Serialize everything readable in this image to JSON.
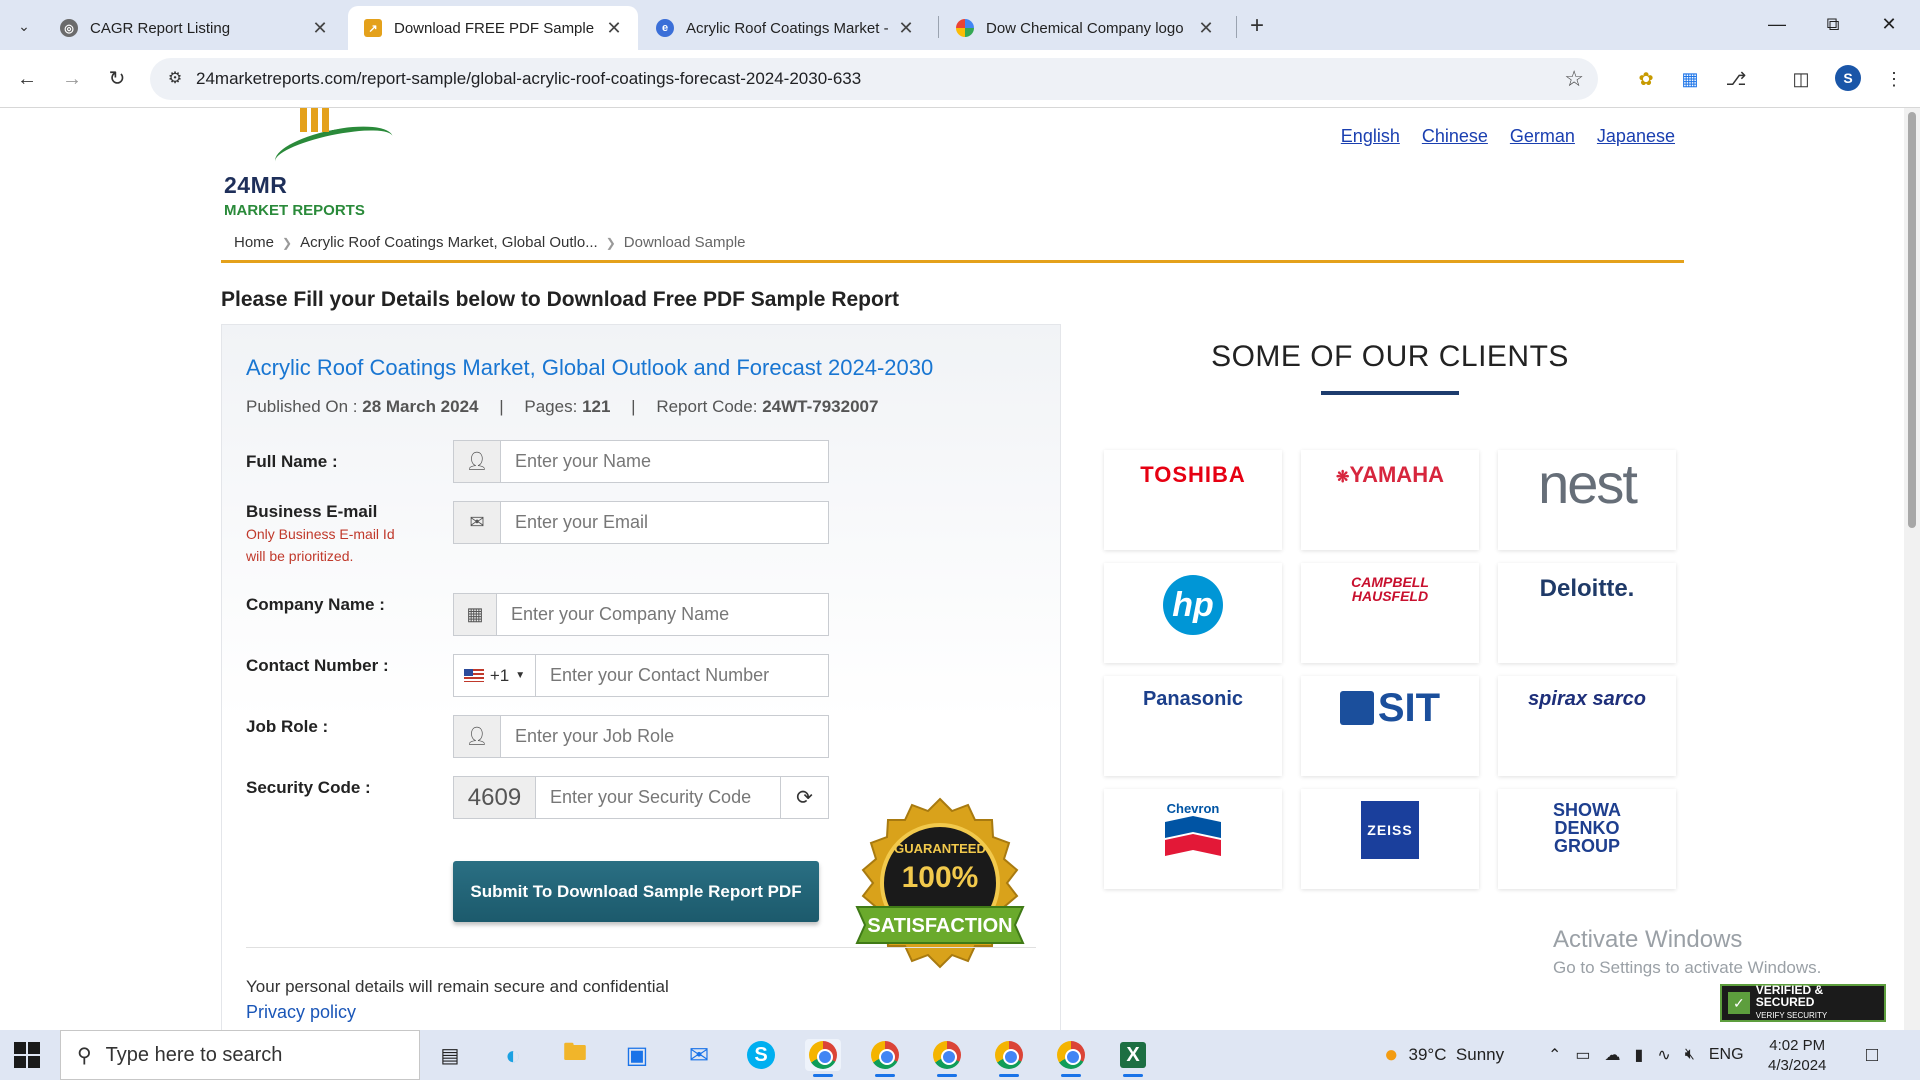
{
  "browser": {
    "tabs": [
      {
        "title": "CAGR Report Listing",
        "icon": "globe-icon",
        "active": false
      },
      {
        "title": "Download FREE PDF Sample : A",
        "icon": "24mr-favicon",
        "active": true
      },
      {
        "title": "Acrylic Roof Coatings Market -",
        "icon": "edge-favicon",
        "active": false
      },
      {
        "title": "Dow Chemical Company logo p",
        "icon": "google-favicon",
        "active": false
      }
    ],
    "url": "24marketreports.com/report-sample/global-acrylic-roof-coatings-forecast-2024-2030-633",
    "profile_initial": "S"
  },
  "site": {
    "logo_mark": "24MR",
    "logo_sub": "MARKET REPORTS",
    "languages": [
      "English",
      "Chinese",
      "German",
      "Japanese"
    ]
  },
  "breadcrumb": {
    "home": "Home",
    "report": "Acrylic Roof Coatings Market, Global Outlo...",
    "current": "Download Sample"
  },
  "page_title": "Please Fill your Details below to Download Free PDF Sample Report",
  "report": {
    "title": "Acrylic Roof Coatings Market, Global Outlook and Forecast 2024-2030",
    "published_label": "Published On :",
    "published": "28 March 2024",
    "pages_label": "Pages:",
    "pages": "121",
    "code_label": "Report Code:",
    "code": "24WT-7932007"
  },
  "form": {
    "full_name_label": "Full Name :",
    "full_name_placeholder": "Enter your Name",
    "email_label": "Business E-mail",
    "email_note": "Only Business E-mail Id will be prioritized.",
    "email_placeholder": "Enter your Email",
    "company_label": "Company Name :",
    "company_placeholder": "Enter your Company Name",
    "contact_label": "Contact Number :",
    "country_code": "+1",
    "contact_placeholder": "Enter your Contact Number",
    "job_label": "Job Role :",
    "job_placeholder": "Enter your Job Role",
    "security_label": "Security Code :",
    "security_code": "4609",
    "security_placeholder": "Enter your Security Code",
    "submit_label": "Submit To Download Sample Report PDF",
    "secure_note": "Your personal details will remain secure and confidential",
    "privacy_link": "Privacy policy"
  },
  "seal": {
    "top": "GUARANTEED",
    "percent": "100%",
    "bottom": "SATISFACTION"
  },
  "clients": {
    "title": "SOME OF OUR CLIENTS",
    "logos": [
      {
        "name": "TOSHIBA",
        "color": "#e60012"
      },
      {
        "name": "YAMAHA",
        "color": "#d7263d"
      },
      {
        "name": "nest",
        "color": "#666e78"
      },
      {
        "name": "hp",
        "color": "#0096d6"
      },
      {
        "name": "CAMPBELL HAUSFELD",
        "color": "#c8102e"
      },
      {
        "name": "Deloitte.",
        "color": "#1f3a68"
      },
      {
        "name": "Panasonic",
        "color": "#1b3f8b"
      },
      {
        "name": "SIT",
        "color": "#1b4f9c"
      },
      {
        "name": "spirax sarco",
        "color": "#1e2f7a"
      },
      {
        "name": "Chevron",
        "color": "#0054a4"
      },
      {
        "name": "ZEISS",
        "color": "#1a3f9c"
      },
      {
        "name": "SHOWA DENKO GROUP",
        "color": "#1e3f8f"
      }
    ]
  },
  "windows_watermark": {
    "line1": "Activate Windows",
    "line2": "Go to Settings to activate Windows."
  },
  "godaddy": {
    "line1": "VERIFIED & SECURED",
    "line2": "VERIFY SECURITY"
  },
  "taskbar": {
    "search_placeholder": "Type here to search",
    "weather": "39°C  Sunny",
    "language": "ENG",
    "time": "4:02 PM",
    "date": "4/3/2024"
  }
}
